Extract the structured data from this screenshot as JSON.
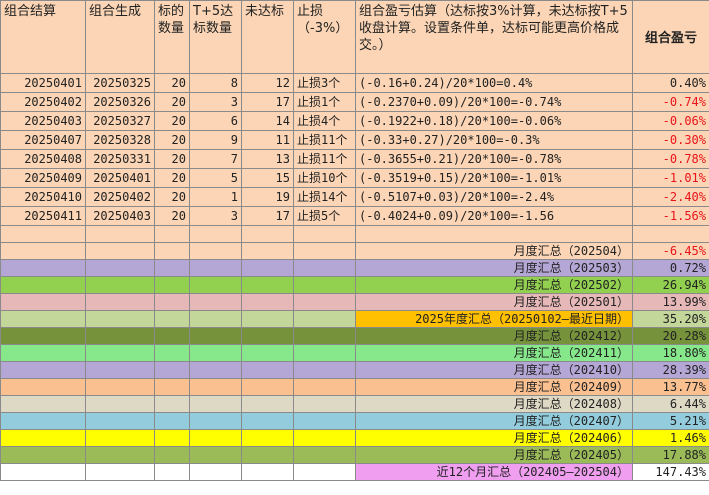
{
  "colors": {
    "peach": "#fbd5b5",
    "negative_text": "#e8141b"
  },
  "headers": {
    "group_end": "组合结算",
    "group_gen": "组合生成",
    "target_count": "标的数量",
    "t5_count": "T+5达标数量",
    "not_reached": "未达标",
    "stop_loss": "止损（-3%）",
    "estimate": "组合盈亏估算（达标按3%计算，未达标按T+5收盘计算。设置条件单，达标可能更高价格成交。）",
    "result": "组合盈亏"
  },
  "rows": [
    {
      "end": "20250401",
      "gen": "20250325",
      "count": "20",
      "t5": "8",
      "miss": "12",
      "stop": "止损3个",
      "formula": "(-0.16+0.24)/20*100=0.4%",
      "result": "0.40%",
      "neg": false
    },
    {
      "end": "20250402",
      "gen": "20250326",
      "count": "20",
      "t5": "3",
      "miss": "17",
      "stop": "止损1个",
      "formula": "(-0.2370+0.09)/20*100=-0.74%",
      "result": "-0.74%",
      "neg": true
    },
    {
      "end": "20250403",
      "gen": "20250327",
      "count": "20",
      "t5": "6",
      "miss": "14",
      "stop": "止损4个",
      "formula": "(-0.1922+0.18)/20*100=-0.06%",
      "result": "-0.06%",
      "neg": true
    },
    {
      "end": "20250407",
      "gen": "20250328",
      "count": "20",
      "t5": "9",
      "miss": "11",
      "stop": "止损11个",
      "formula": "(-0.33+0.27)/20*100=-0.3%",
      "result": "-0.30%",
      "neg": true
    },
    {
      "end": "20250408",
      "gen": "20250331",
      "count": "20",
      "t5": "7",
      "miss": "13",
      "stop": "止损11个",
      "formula": "(-0.3655+0.21)/20*100=-0.78%",
      "result": "-0.78%",
      "neg": true
    },
    {
      "end": "20250409",
      "gen": "20250401",
      "count": "20",
      "t5": "5",
      "miss": "15",
      "stop": "止损10个",
      "formula": "(-0.3519+0.15)/20*100=-1.01%",
      "result": "-1.01%",
      "neg": true
    },
    {
      "end": "20250410",
      "gen": "20250402",
      "count": "20",
      "t5": "1",
      "miss": "19",
      "stop": "止损14个",
      "formula": "(-0.5107+0.03)/20*100=-2.4%",
      "result": "-2.40%",
      "neg": true
    },
    {
      "end": "20250411",
      "gen": "20250403",
      "count": "20",
      "t5": "3",
      "miss": "17",
      "stop": "止损5个",
      "formula": "(-0.4024+0.09)/20*100=-1.56",
      "result": "-1.56%",
      "neg": true
    }
  ],
  "summaries": [
    {
      "label": "月度汇总（202504）",
      "value": "-6.45%",
      "neg": true,
      "bg": "#fbd5b5"
    },
    {
      "label": "月度汇总（202503）",
      "value": "0.72%",
      "neg": false,
      "bg": "#b4a7d6"
    },
    {
      "label": "月度汇总（202502）",
      "value": "26.94%",
      "neg": false,
      "bg": "#92d050"
    },
    {
      "label": "月度汇总（202501）",
      "value": "13.99%",
      "neg": false,
      "bg": "#e6b8b7"
    },
    {
      "label": "2025年度汇总（20250102—最近日期）",
      "value": "35.20%",
      "neg": false,
      "bg": "#c4d79b",
      "label_bg": "#ffc000"
    },
    {
      "label": "月度汇总（202412）",
      "value": "20.28%",
      "neg": false,
      "bg": "#76933c"
    },
    {
      "label": "月度汇总（202411）",
      "value": "18.80%",
      "neg": false,
      "bg": "#86e88a"
    },
    {
      "label": "月度汇总（202410）",
      "value": "28.39%",
      "neg": false,
      "bg": "#b4a7d6"
    },
    {
      "label": "月度汇总（202409）",
      "value": "13.77%",
      "neg": false,
      "bg": "#fac090"
    },
    {
      "label": "月度汇总（202408）",
      "value": "6.44%",
      "neg": false,
      "bg": "#ddd9c4"
    },
    {
      "label": "月度汇总（202407）",
      "value": "5.21%",
      "neg": false,
      "bg": "#93cddd"
    },
    {
      "label": "月度汇总（202406）",
      "value": "1.46%",
      "neg": false,
      "bg": "#ffff00"
    },
    {
      "label": "月度汇总（202405）",
      "value": "17.88%",
      "neg": false,
      "bg": "#9bbb59"
    },
    {
      "label": "近12个月汇总（202405—202504）",
      "value": "147.43%",
      "neg": false,
      "bg": "#ffffff",
      "label_bg": "#f09ff0"
    }
  ]
}
